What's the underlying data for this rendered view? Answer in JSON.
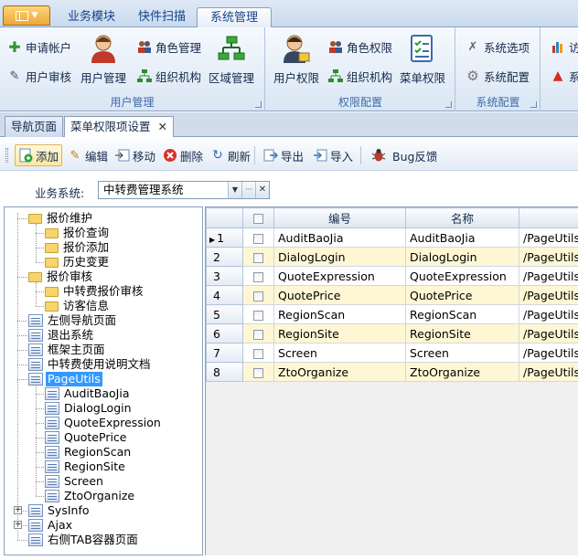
{
  "ribbon_tabs": [
    "业务模块",
    "快件扫描",
    "系统管理"
  ],
  "groups": {
    "user": {
      "label": "用户管理",
      "apply": "申请帐户",
      "audit": "用户审核",
      "user_mgmt": "用户管理",
      "role_mgmt": "角色管理",
      "org": "组织机构",
      "area": "区域管理"
    },
    "perm": {
      "label": "权限配置",
      "user_perm": "用户权限",
      "role_perm": "角色权限",
      "org": "组织机构",
      "menu_perm": "菜单权限"
    },
    "sys": {
      "label": "系统配置",
      "options": "系统选项",
      "config": "系统配置"
    },
    "extra": {
      "item1": "访",
      "item2": "系"
    }
  },
  "doc_tabs": {
    "nav": "导航页面",
    "menu": "菜单权限项设置",
    "close": "✕"
  },
  "toolbar": {
    "add": "添加",
    "edit": "编辑",
    "move": "移动",
    "delete": "删除",
    "refresh": "刷新",
    "export": "导出",
    "import": "导入",
    "bug": "Bug反馈"
  },
  "filter": {
    "label": "业务系统:",
    "value": "中转费管理系统",
    "dd": "▼",
    "more": "···",
    "clear": "✕"
  },
  "tree": [
    {
      "label": "报价维护",
      "level": 0,
      "icon": "folder"
    },
    {
      "label": "报价查询",
      "level": 1,
      "icon": "folder"
    },
    {
      "label": "报价添加",
      "level": 1,
      "icon": "folder"
    },
    {
      "label": "历史变更",
      "level": 1,
      "icon": "folder"
    },
    {
      "label": "报价审核",
      "level": 0,
      "icon": "folder"
    },
    {
      "label": "中转费报价审核",
      "level": 1,
      "icon": "folder"
    },
    {
      "label": "访客信息",
      "level": 1,
      "icon": "folder"
    },
    {
      "label": "左侧导航页面",
      "level": 0,
      "icon": "page"
    },
    {
      "label": "退出系统",
      "level": 0,
      "icon": "page"
    },
    {
      "label": "框架主页面",
      "level": 0,
      "icon": "page"
    },
    {
      "label": "中转费使用说明文档",
      "level": 0,
      "icon": "page"
    },
    {
      "label": "PageUtils",
      "level": 0,
      "icon": "page",
      "selected": true
    },
    {
      "label": "AuditBaoJia",
      "level": 1,
      "icon": "page"
    },
    {
      "label": "DialogLogin",
      "level": 1,
      "icon": "page"
    },
    {
      "label": "QuoteExpression",
      "level": 1,
      "icon": "page"
    },
    {
      "label": "QuotePrice",
      "level": 1,
      "icon": "page"
    },
    {
      "label": "RegionScan",
      "level": 1,
      "icon": "page"
    },
    {
      "label": "RegionSite",
      "level": 1,
      "icon": "page"
    },
    {
      "label": "Screen",
      "level": 1,
      "icon": "page"
    },
    {
      "label": "ZtoOrganize",
      "level": 1,
      "icon": "page"
    },
    {
      "label": "SysInfo",
      "level": 0,
      "icon": "page",
      "expander": "+"
    },
    {
      "label": "Ajax",
      "level": 0,
      "icon": "page",
      "expander": "+"
    },
    {
      "label": "右侧TAB容器页面",
      "level": 0,
      "icon": "page"
    }
  ],
  "grid": {
    "columns": [
      "编号",
      "名称"
    ],
    "rows": [
      {
        "n": "1",
        "code": "AuditBaoJia",
        "name": "AuditBaoJia",
        "url": "/PageUtils/A",
        "current": true
      },
      {
        "n": "2",
        "code": "DialogLogin",
        "name": "DialogLogin",
        "url": "/PageUtils/I"
      },
      {
        "n": "3",
        "code": "QuoteExpression",
        "name": "QuoteExpression",
        "url": "/PageUtils/Q"
      },
      {
        "n": "4",
        "code": "QuotePrice",
        "name": "QuotePrice",
        "url": "/PageUtils/Q"
      },
      {
        "n": "5",
        "code": "RegionScan",
        "name": "RegionScan",
        "url": "/PageUtils/I"
      },
      {
        "n": "6",
        "code": "RegionSite",
        "name": "RegionSite",
        "url": "/PageUtils/I"
      },
      {
        "n": "7",
        "code": "Screen",
        "name": "Screen",
        "url": "/PageUtils/S"
      },
      {
        "n": "8",
        "code": "ZtoOrganize",
        "name": "ZtoOrganize",
        "url": "/PageUtils/Z"
      }
    ]
  },
  "colors": {
    "accent": "#f0a63a",
    "selection": "#3399ff",
    "row_alt": "#fff7d4"
  }
}
